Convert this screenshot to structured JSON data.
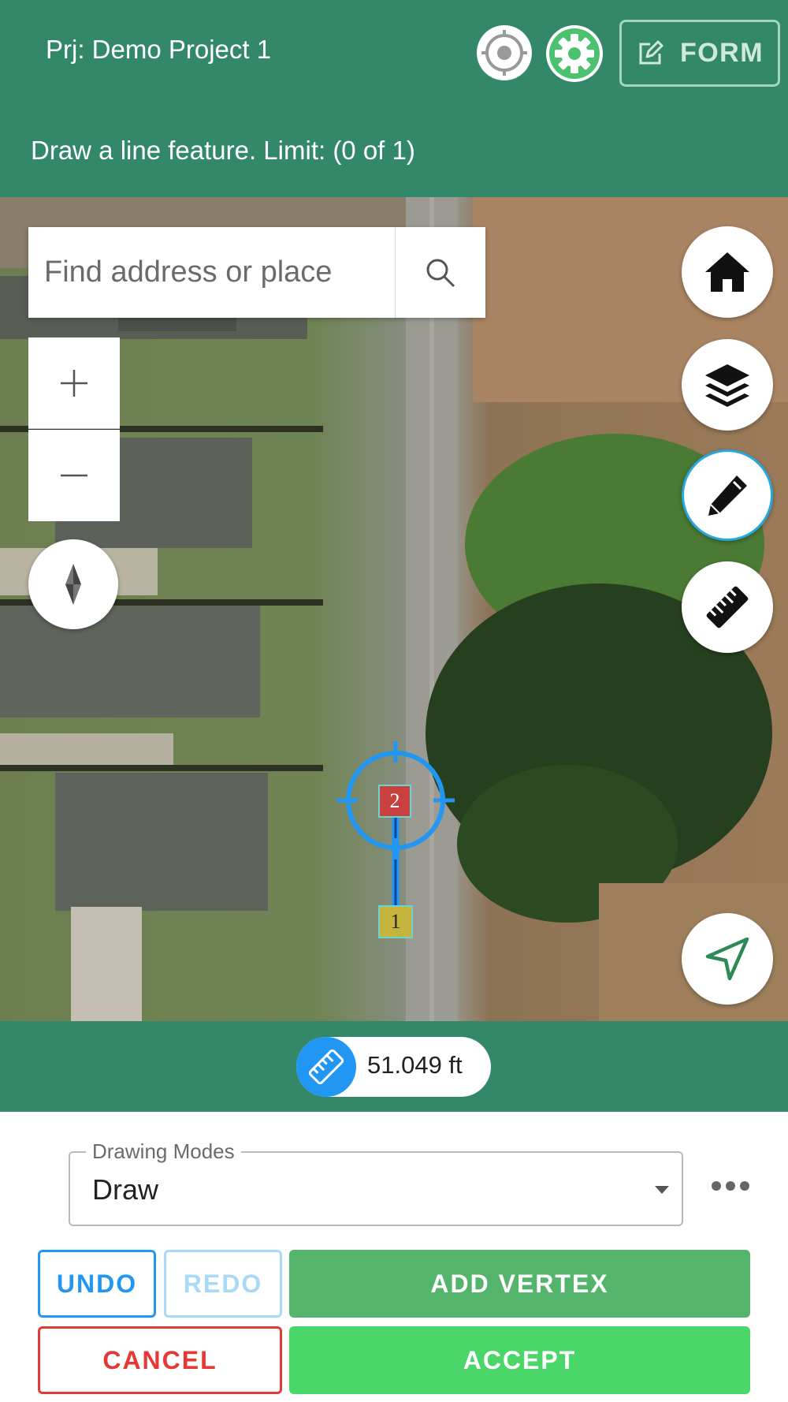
{
  "header": {
    "project_title": "Prj: Demo Project 1",
    "instruction": "Draw a line feature. Limit: (0 of 1)",
    "form_label": "FORM",
    "icons": {
      "gps": "gps-target-icon",
      "settings": "gear-icon",
      "form": "edit-icon"
    }
  },
  "map": {
    "search_placeholder": "Find address or place",
    "vertices": [
      {
        "label": "1",
        "color": "#c6b53c"
      },
      {
        "label": "2",
        "color": "#c94040"
      }
    ],
    "tools": [
      "home-icon",
      "layers-icon",
      "pencil-icon",
      "ruler-icon",
      "navigation-arrow-icon"
    ],
    "active_tool": "pencil-icon"
  },
  "measurement": {
    "value": "51.049 ft"
  },
  "drawing": {
    "modes_label": "Drawing Modes",
    "mode_value": "Draw"
  },
  "buttons": {
    "undo": "UNDO",
    "redo": "REDO",
    "add_vertex": "ADD VERTEX",
    "cancel": "CANCEL",
    "accept": "ACCEPT"
  },
  "colors": {
    "brand": "#33886a",
    "primary": "#2196f3",
    "danger": "#e53935",
    "success": "#55b46b",
    "accept": "#4bd66a"
  }
}
